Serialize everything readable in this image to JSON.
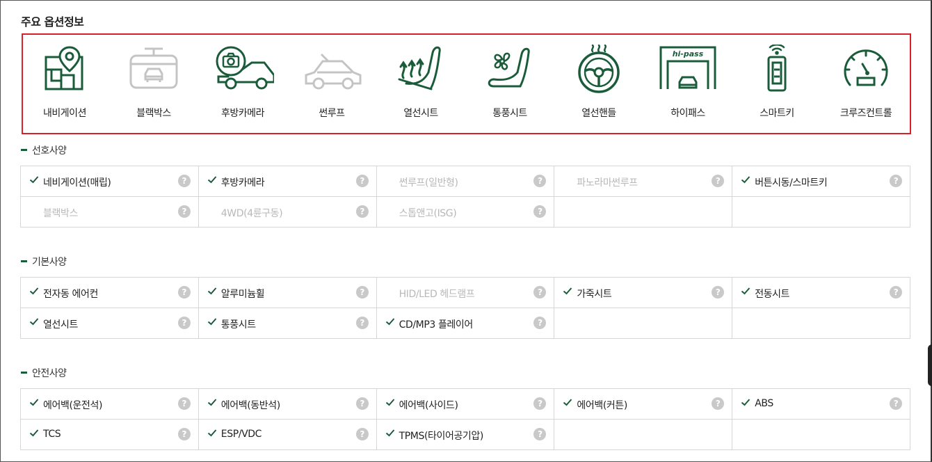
{
  "title": "주요 옵션정보",
  "colors": {
    "active_icon": "#1a5c3a",
    "inactive_icon": "#c4c4c4",
    "highlight_border": "#d9202a"
  },
  "main_options": [
    {
      "label": "내비게이션",
      "icon": "navigation-map-icon",
      "active": true
    },
    {
      "label": "블랙박스",
      "icon": "blackbox-camera-icon",
      "active": false
    },
    {
      "label": "후방카메라",
      "icon": "rear-camera-icon",
      "active": true
    },
    {
      "label": "썬루프",
      "icon": "sunroof-car-icon",
      "active": false
    },
    {
      "label": "열선시트",
      "icon": "heated-seat-icon",
      "active": true
    },
    {
      "label": "통풍시트",
      "icon": "ventilated-seat-icon",
      "active": true
    },
    {
      "label": "열선핸들",
      "icon": "heated-steering-wheel-icon",
      "active": true
    },
    {
      "label": "하이패스",
      "icon": "hipass-icon",
      "active": true,
      "logo_text": "hi-pass"
    },
    {
      "label": "스마트키",
      "icon": "smart-key-icon",
      "active": true
    },
    {
      "label": "크루즈컨트롤",
      "icon": "cruise-control-gauge-icon",
      "active": true
    }
  ],
  "sections": [
    {
      "title": "선호사양",
      "rows": [
        [
          {
            "label": "네비게이션(매립)",
            "active": true
          },
          {
            "label": "후방카메라",
            "active": true
          },
          {
            "label": "썬루프(일반형)",
            "active": false
          },
          {
            "label": "파노라마썬루프",
            "active": false
          },
          {
            "label": "버튼시동/스마트키",
            "active": true
          }
        ],
        [
          {
            "label": "블랙박스",
            "active": false
          },
          {
            "label": "4WD(4륜구동)",
            "active": false
          },
          {
            "label": "스톱앤고(ISG)",
            "active": false
          },
          null,
          null
        ]
      ]
    },
    {
      "title": "기본사양",
      "rows": [
        [
          {
            "label": "전자동 에어컨",
            "active": true
          },
          {
            "label": "알루미늄휠",
            "active": true
          },
          {
            "label": "HID/LED 헤드램프",
            "active": false
          },
          {
            "label": "가죽시트",
            "active": true
          },
          {
            "label": "전동시트",
            "active": true
          }
        ],
        [
          {
            "label": "열선시트",
            "active": true
          },
          {
            "label": "통풍시트",
            "active": true
          },
          {
            "label": "CD/MP3 플레이어",
            "active": true
          },
          null,
          null
        ]
      ]
    },
    {
      "title": "안전사양",
      "rows": [
        [
          {
            "label": "에어백(운전석)",
            "active": true
          },
          {
            "label": "에어백(동반석)",
            "active": true
          },
          {
            "label": "에어백(사이드)",
            "active": true
          },
          {
            "label": "에어백(커튼)",
            "active": true
          },
          {
            "label": "ABS",
            "active": true
          }
        ],
        [
          {
            "label": "TCS",
            "active": true
          },
          {
            "label": "ESP/VDC",
            "active": true
          },
          {
            "label": "TPMS(타이어공기압)",
            "active": true
          },
          null,
          null
        ]
      ]
    }
  ],
  "help_icon_text": "?"
}
